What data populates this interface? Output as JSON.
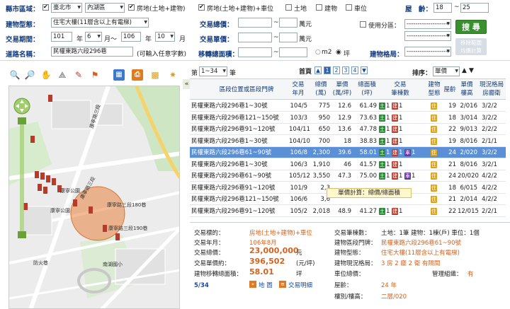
{
  "filters": {
    "district_label": "縣市區域：",
    "city": "臺北市",
    "district": "內湖區",
    "checks": [
      {
        "label": "房地(土地+建物)",
        "checked": true
      },
      {
        "label": "房地(土地+建物)+車位",
        "checked": true
      },
      {
        "label": "土地",
        "checked": false
      },
      {
        "label": "建物",
        "checked": false
      },
      {
        "label": "車位",
        "checked": false
      }
    ],
    "age_label": "屋　齡：",
    "age_from": "18",
    "age_to": "25",
    "building_type_label": "建物型態：",
    "building_type": "住宅大樓(11層含以上有電梯)",
    "total_price_label": "交易總價：",
    "wan_unit_1": "萬元",
    "unit_price_label": "交易單價：",
    "wan_unit_2": "萬元",
    "area_label": "移轉總面積：",
    "partition_label": "使用分區：",
    "partition_value_1": "--------------------",
    "partition_value_2": "--------------------",
    "period_label": "交易期間：",
    "year_from": "101",
    "year_unit_1": "年",
    "month_from": "6",
    "month_unit_1": "月～",
    "year_to": "106",
    "year_unit_2": "年",
    "month_to": "10",
    "month_unit_2": "月",
    "road_label": "道路名稱：",
    "road_value": "民權東路六段296巷",
    "road_hint": "(可輸入任意字數)",
    "layout_label": "建物格局：",
    "layout_value": "--------------------",
    "m2_label": "m2",
    "ping_label": "坪",
    "search_button": "搜 尋",
    "reset_button": "移除範圍\n均價計算"
  },
  "results": {
    "page_prefix": "第",
    "page_range": "1~34",
    "page_suffix": "筆",
    "home_label": "首頁",
    "pages": [
      "1",
      "2",
      "3",
      "4"
    ],
    "sort_label": "排序：",
    "sort_value": "單價",
    "headers": {
      "location": "區段位置或區段門牌",
      "trade_date": "交易\n年月",
      "total": "總價\n(萬)",
      "unit": "單價\n(萬/坪)",
      "area": "總面積\n(坪)",
      "count": "交易\n筆棟數",
      "btype": "建物\n型態",
      "age": "屋齡",
      "floor": "單價\n樓高",
      "layout": "現況格局\n房廳衛"
    },
    "rows": [
      {
        "addr": "民權東路六段296巷1~30號",
        "date": "104/5",
        "total": "775",
        "unit": "12.6",
        "area": "61.49",
        "cnt": "1",
        "age": "19",
        "floor": "2/016",
        "layout": "3/2/2",
        "car": false
      },
      {
        "addr": "民權東路六段296巷121~150號",
        "date": "103/3",
        "total": "950",
        "unit": "12.9",
        "area": "73.63",
        "cnt": "1",
        "age": "18",
        "floor": "3/014",
        "layout": "3/2/2",
        "car": false
      },
      {
        "addr": "民權東路六段296巷91~120號",
        "date": "104/11",
        "total": "650",
        "unit": "13.6",
        "area": "47.78",
        "cnt": "1",
        "age": "22",
        "floor": "9/013",
        "layout": "2/2/2",
        "car": false
      },
      {
        "addr": "民權東路六段296巷1~30號",
        "date": "104/10",
        "total": "700",
        "unit": "18",
        "area": "38.83",
        "cnt": "1",
        "age": "19",
        "floor": "8/016",
        "layout": "2/1/1",
        "car": false
      },
      {
        "addr": "民權東路六段296巷61~90號",
        "date": "106/8",
        "total": "2,300",
        "unit": "39.6",
        "area": "58.01",
        "cnt": "1",
        "age": "24",
        "floor": "2/020",
        "layout": "3/2/2",
        "car": true
      },
      {
        "addr": "民權東路六段296巷1~30號",
        "date": "106/3",
        "total": "1,910",
        "unit": "46",
        "area": "41.57",
        "cnt": "1",
        "age": "21",
        "floor": "8/016",
        "layout": "3/2/1",
        "car": false
      },
      {
        "addr": "民權東路六段296巷61~90號",
        "date": "105/12",
        "total": "3,550",
        "unit": "47.3",
        "area": "75.00",
        "cnt": "1",
        "age": "24",
        "floor": "20/020",
        "layout": "4/2/2",
        "car": true
      },
      {
        "addr": "民權東路六段296巷91~120號",
        "date": "101/9",
        "total": "2,3",
        "unit": "",
        "area": "",
        "cnt": "",
        "age": "18",
        "floor": "6/015",
        "layout": "4/2/2",
        "car": false
      },
      {
        "addr": "民權東路六段296巷121~150號",
        "date": "106/6",
        "total": "3,6",
        "unit": "",
        "area": "",
        "cnt": "",
        "age": "21",
        "floor": "2/014",
        "layout": "4/2/2",
        "car": false
      },
      {
        "addr": "民權東路六段296巷91~120號",
        "date": "105/2",
        "total": "2,018",
        "unit": "48.9",
        "area": "41.27",
        "cnt": "1",
        "age": "22",
        "floor": "12/015",
        "layout": "2/2/1",
        "car": false
      }
    ],
    "tooltip": "單價計算：總價/總面積",
    "tag_land": "土",
    "tag_bld": "建",
    "tag_car": "車",
    "tag_type": "住"
  },
  "detail": {
    "target_label": "交易標的：",
    "target_value": "房地(土地+建物)+車位",
    "date_label": "交易年月：",
    "date_value": "106年8月",
    "total_label": "交易總價：",
    "total_value": "23,000,000",
    "total_unit": "元",
    "unit_label": "交易單價約：",
    "unit_value": "396,502",
    "unit_unit": "(元/坪)",
    "area_label": "建物移轉總面積：",
    "area_value": "58.01",
    "area_unit": "坪",
    "index": "5/34",
    "map_link": "地 圖",
    "detail_link": "交易明細",
    "count_label": "交易筆棟數：",
    "count_value": "土地：1筆 建物：1棟(戶) 車位：1個",
    "door_label": "建物區段門牌：",
    "door_value": "民權東路六段296巷61~90號",
    "btype_label": "建物型態：",
    "btype_value": "住宅大樓(11層含以上有電梯)",
    "layout_label": "建物現況格局：",
    "layout_value": "3 房 2 廳 2 衛 有隔間",
    "car_label": "車位總價：",
    "mgmt_label": "管理組織：",
    "mgmt_value": "有",
    "age_label": "屋齡：",
    "age_value": "24 年",
    "floor_label": "樓別/樓高：",
    "floor_value": "二層/020"
  },
  "map": {
    "roads": [
      "康寧路三段",
      "康寧路三段180巷",
      "康寧路三段190巷",
      "康寧路三段"
    ],
    "places": [
      "康寧公園",
      "防火巷",
      "南湖國小",
      "康寧公園"
    ]
  }
}
